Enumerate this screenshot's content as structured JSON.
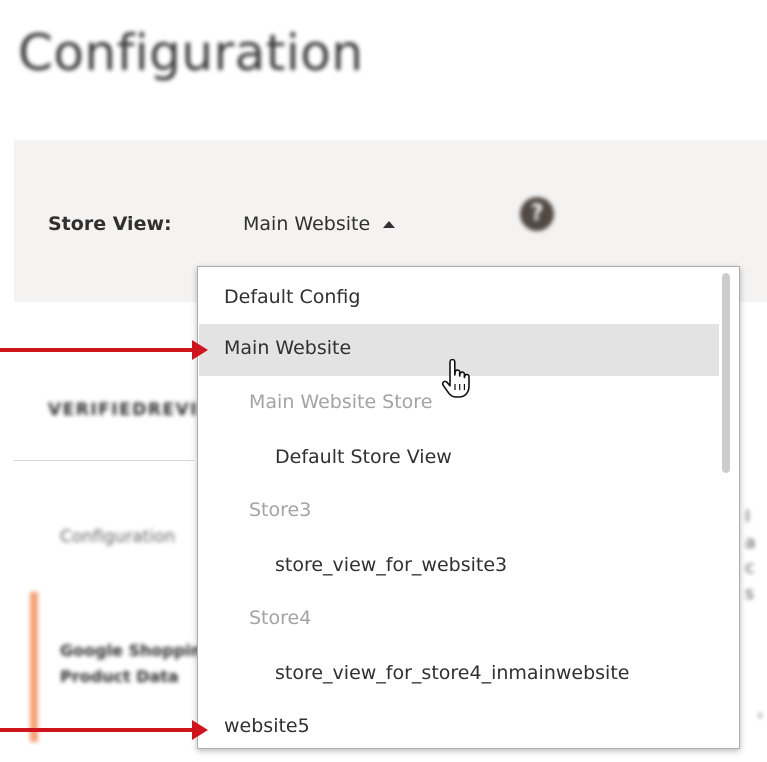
{
  "page": {
    "title": "Configuration"
  },
  "scope": {
    "label": "Store View:",
    "current": "Main Website",
    "help_icon": "help-question-icon"
  },
  "background": {
    "section_title": "VERIFIEDREVIEWS",
    "config_tab": "Configuration",
    "item_line1": "Google Shopping",
    "item_line2": "Product Data",
    "right_text": "I a c s"
  },
  "dropdown": {
    "items": [
      {
        "label": "Default Config",
        "type": "option"
      },
      {
        "label": "Main Website",
        "type": "option",
        "hovered": true
      },
      {
        "label": "Main Website Store",
        "type": "group"
      },
      {
        "label": "Default Store View",
        "type": "option"
      },
      {
        "label": "Store3",
        "type": "group"
      },
      {
        "label": "store_view_for_website3",
        "type": "option"
      },
      {
        "label": "Store4",
        "type": "group"
      },
      {
        "label": "store_view_for_store4_inmainwebsite",
        "type": "option"
      },
      {
        "label": "website5",
        "type": "option"
      }
    ]
  },
  "annotations": {
    "arrow_color": "#d0141e",
    "arrow_targets": [
      "Main Website",
      "website5"
    ]
  },
  "colors": {
    "hover_background": "#e3e3e3",
    "group_text": "#a3a3a3",
    "store_bar_background": "#f4f3f2"
  }
}
